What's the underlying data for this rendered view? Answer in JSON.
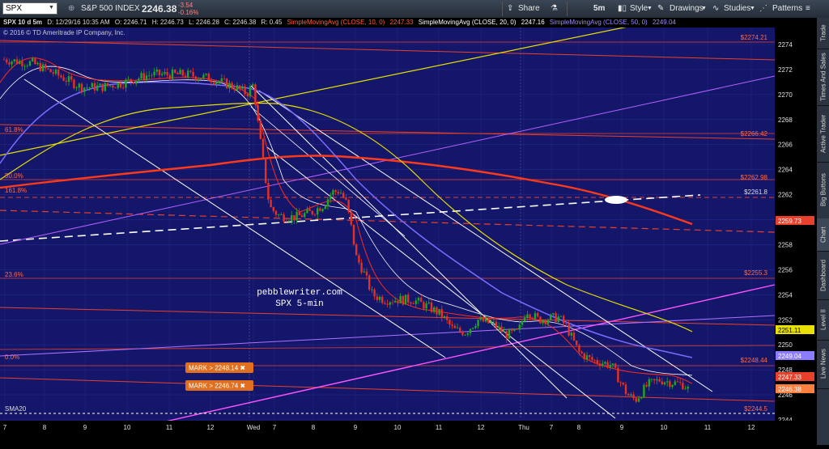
{
  "toolbar": {
    "symbol": "SPX",
    "description": "S&P 500 INDEX",
    "last": "2246.38",
    "change": "-3.54",
    "change_pct": "-0.16%",
    "share": "Share",
    "interval": "5m",
    "style": "Style",
    "drawings": "Drawings",
    "studies": "Studies",
    "patterns": "Patterns"
  },
  "infobar": {
    "title": "SPX 10 d 5m",
    "date": "D: 12/29/16 10:35 AM",
    "open": "O: 2246.71",
    "high": "H: 2246.73",
    "low": "L: 2246.28",
    "close": "C: 2246.38",
    "range": "R: 0.45",
    "sma10": "SimpleMovingAvg (CLOSE, 10, 0)",
    "sma10_val": "2247.33",
    "sma20": "SimpleMovingAvg (CLOSE, 20, 0)",
    "sma20_val": "2247.16",
    "sma50": "SimpleMovingAvg (CLOSE, 50, 0)",
    "sma50_val": "2249.04",
    "copyright": "© 2016 © TD Ameritrade IP Company, Inc."
  },
  "chart_data": {
    "type": "candlestick",
    "y_range": [
      2243,
      2275.5
    ],
    "y_ticks": [
      "2244",
      "2246",
      "2248",
      "2250",
      "2252",
      "2254",
      "2256",
      "2258",
      "2260",
      "2262",
      "2264",
      "2266",
      "2268",
      "2270",
      "2272",
      "2274"
    ],
    "x_ticks": [
      "7",
      "8",
      "9",
      "10",
      "11",
      "12",
      "Wed",
      "7",
      "8",
      "9",
      "10",
      "11",
      "12",
      "Thu",
      "7",
      "8",
      "9",
      "10",
      "11",
      "12"
    ],
    "fib_labels": [
      "61.8%",
      "50.0%",
      "161.8%",
      "23.6%",
      "0.0%"
    ],
    "level_labels": [
      "$2274.21",
      "$2266.42",
      "$2262.98",
      "$2261.8",
      "$2255.3",
      "$2248.44",
      "$2244.5"
    ],
    "price_badges": [
      {
        "text": "2259.73",
        "color": "#e8402a"
      },
      {
        "text": "2251.11",
        "color": "#e8e000"
      },
      {
        "text": "2249.04",
        "color": "#8c7cff"
      },
      {
        "text": "2247.33",
        "color": "#e8402a"
      },
      {
        "text": "2246.38",
        "color": "#ff7f3f"
      }
    ],
    "marks": [
      "MARK > 2248.14",
      "MARK > 2246.74"
    ],
    "annotation": [
      "pebblewriter.com",
      "SPX 5-min"
    ],
    "study_label": "SMA20"
  },
  "sidebar": [
    "Trade",
    "Times And Sales",
    "Active Trader",
    "Big Buttons",
    "Chart",
    "Dashboard",
    "Level II",
    "Live News"
  ]
}
